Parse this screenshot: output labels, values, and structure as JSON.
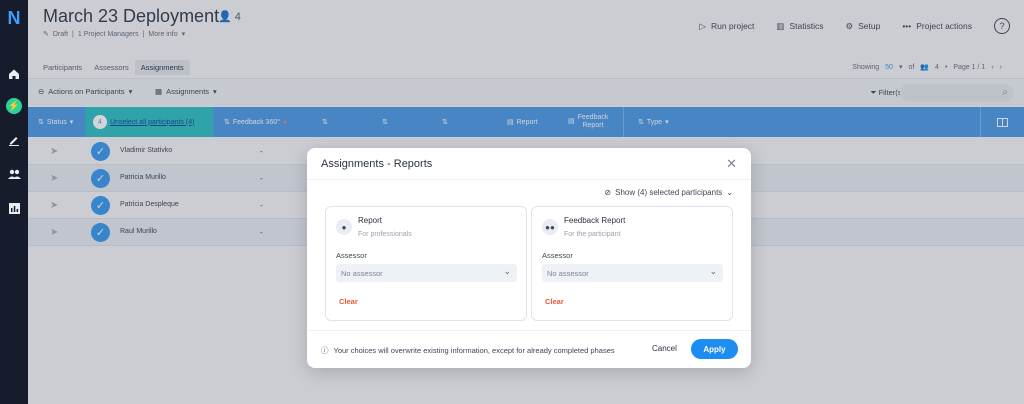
{
  "rail": {
    "logo": "N",
    "items": [
      "home-icon",
      "bolt-icon",
      "pen-icon",
      "users-icon",
      "chart-icon"
    ]
  },
  "header": {
    "title": "March 23 Deployment",
    "people_count": "4",
    "status": "Draft",
    "managers": "1 Project Managers",
    "more_info": "More info"
  },
  "actions": {
    "run": "Run project",
    "stats": "Statistics",
    "setup": "Setup",
    "project_actions": "Project actions",
    "help": "?"
  },
  "tabs": [
    "Participants",
    "Assessors",
    "Assignments"
  ],
  "showing": {
    "label": "Showing",
    "count": "50",
    "of": "of",
    "total": "4",
    "page": "Page 1 / 1"
  },
  "toolbar": {
    "actions": "Actions on Participants",
    "assignments": "Assignments",
    "filter": "Filter(s)"
  },
  "table": {
    "status": "Status",
    "selected_count": "4",
    "unselect_all": "Unselect all participants (4)",
    "feedback360": "Feedback 360°",
    "report": "Report",
    "feedback_report_l1": "Feedback",
    "feedback_report_l2": "Report",
    "type": "Type",
    "rows": [
      {
        "name": "Vladimir Stativko",
        "value": "-"
      },
      {
        "name": "Patricia Murillo",
        "value": "-"
      },
      {
        "name": "Patricia Despleque",
        "value": "-"
      },
      {
        "name": "Raul Murillo",
        "value": "-"
      }
    ]
  },
  "modal": {
    "title": "Assignments - Reports",
    "show_selected": "Show (4) selected participants",
    "cards": [
      {
        "title": "Report",
        "subtitle": "For professionals",
        "assessor_label": "Assessor",
        "assessor_value": "No assessor",
        "clear": "Clear"
      },
      {
        "title": "Feedback Report",
        "subtitle": "For the participant",
        "assessor_label": "Assessor",
        "assessor_value": "No assessor",
        "clear": "Clear"
      }
    ],
    "warning": "Your choices will overwrite existing information, except for already completed phases",
    "cancel": "Cancel",
    "apply": "Apply"
  }
}
